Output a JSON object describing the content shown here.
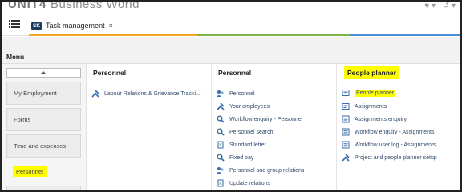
{
  "header": {
    "logo_brand": "UNIT4",
    "logo_product": "Business World",
    "right_icons": [
      "heart-icon",
      "chevron-down-icon",
      "history-icon",
      "chevron-down-icon"
    ],
    "right_glyphs": [
      "♥ ▾",
      "↺ ▾"
    ]
  },
  "tabs": [
    {
      "badge": "SK",
      "label": "Task management",
      "close": "×"
    }
  ],
  "accent_colors": {
    "orange": "#f5a623",
    "green": "#7cb342",
    "blue": "#4a90d9",
    "highlight": "#ffff00",
    "link": "#2f4a6d"
  },
  "menu": {
    "title": "Menu",
    "left_items": [
      {
        "label": "My Employment"
      },
      {
        "label": "Forms"
      },
      {
        "label": "Time and expenses"
      },
      {
        "label": "Personnel",
        "selected": true
      }
    ]
  },
  "columns": [
    {
      "header": "Personnel",
      "items": [
        {
          "label": "Labour Relations & Grievance Tracki...",
          "icon": "tools-icon"
        }
      ]
    },
    {
      "header": "Personnel",
      "items": [
        {
          "label": "Personnel",
          "icon": "people-icon"
        },
        {
          "label": "Your employees",
          "icon": "tools-icon"
        },
        {
          "label": "Workflow enquiry - Personnel",
          "icon": "search-icon"
        },
        {
          "label": "Personnel search",
          "icon": "search-icon"
        },
        {
          "label": "Standard letter",
          "icon": "document-icon"
        },
        {
          "label": "Fixed pay",
          "icon": "search-icon"
        },
        {
          "label": "Personnel and group relations",
          "icon": "people-icon"
        },
        {
          "label": "Update relations",
          "icon": "document-icon"
        }
      ]
    },
    {
      "header": "People planner",
      "items": [
        {
          "label": "People planner",
          "icon": "planner-icon",
          "highlight": true
        },
        {
          "label": "Assignments",
          "icon": "planner-icon"
        },
        {
          "label": "Assignments enquiry",
          "icon": "list-icon"
        },
        {
          "label": "Workflow enquiry - Assignments",
          "icon": "list-icon"
        },
        {
          "label": "Workflow user log - Assignments",
          "icon": "list-icon"
        },
        {
          "label": "Project and people planner setup",
          "icon": "tools-icon"
        }
      ]
    }
  ]
}
